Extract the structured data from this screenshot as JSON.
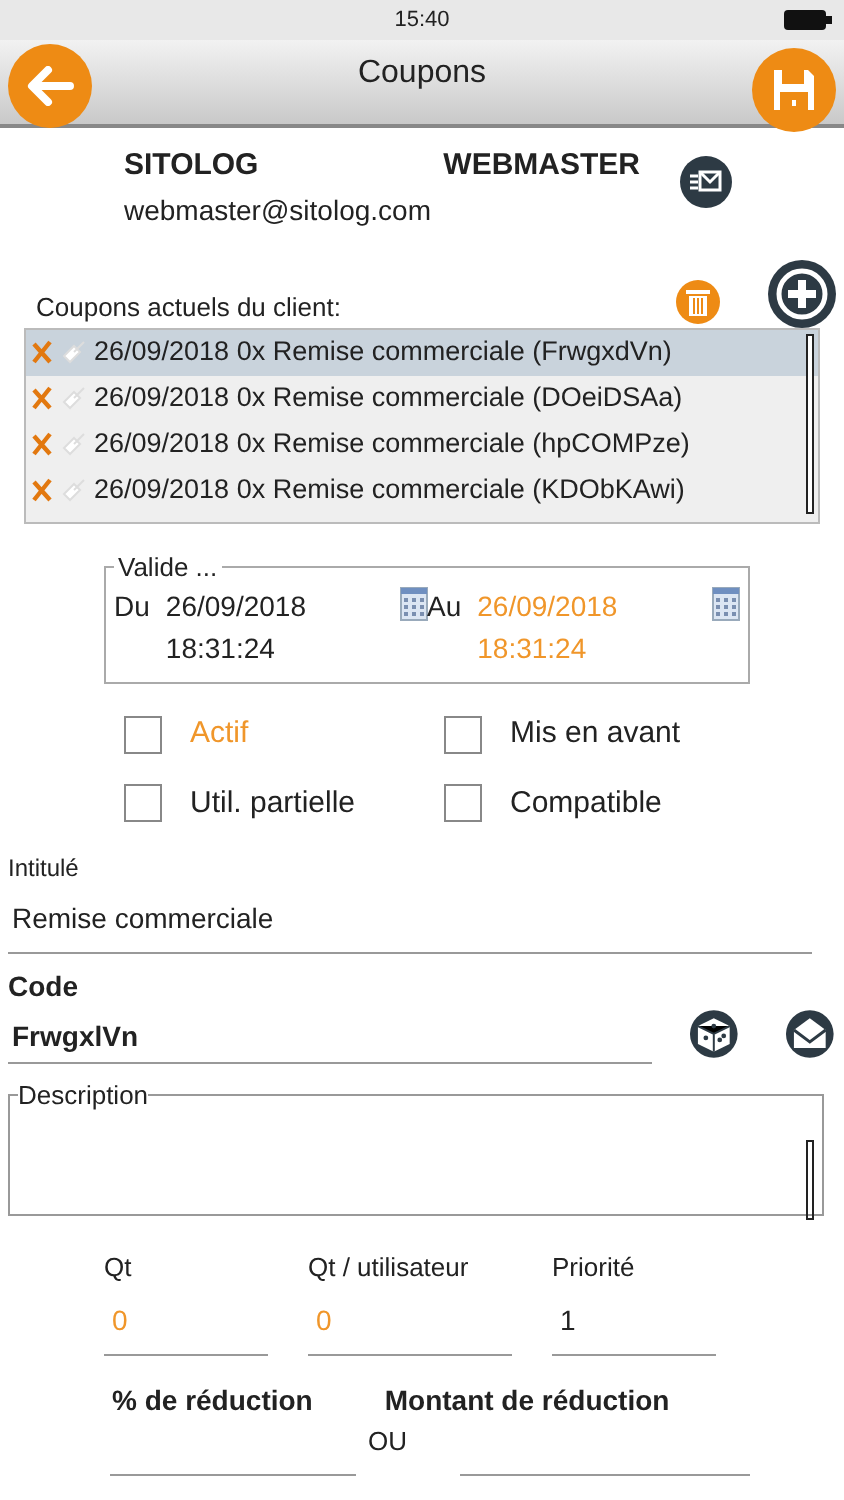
{
  "status_bar": {
    "time": "15:40"
  },
  "header": {
    "title": "Coupons"
  },
  "user": {
    "company": "SITOLOG",
    "name": "WEBMASTER",
    "email": "webmaster@sitolog.com"
  },
  "coupons": {
    "label": "Coupons actuels du client:",
    "items": [
      {
        "text": "26/09/2018 0x Remise commerciale (FrwgxdVn)",
        "selected": true
      },
      {
        "text": "26/09/2018 0x Remise commerciale (DOeiDSAa)",
        "selected": false
      },
      {
        "text": "26/09/2018 0x Remise commerciale (hpCOMPze)",
        "selected": false
      },
      {
        "text": "26/09/2018 0x Remise commerciale (KDObKAwi)",
        "selected": false
      }
    ]
  },
  "validity": {
    "legend": "Valide ...",
    "from": {
      "label": "Du",
      "date": "26/09/2018",
      "time": "18:31:24",
      "highlighted": false
    },
    "to": {
      "label": "Au",
      "date": "26/09/2018",
      "time": "18:31:24",
      "highlighted": true
    }
  },
  "options": [
    {
      "label": "Actif",
      "checked": false,
      "highlighted": true
    },
    {
      "label": "Mis en avant",
      "checked": false,
      "highlighted": false
    },
    {
      "label": "Util. partielle",
      "checked": false,
      "highlighted": false
    },
    {
      "label": "Compatible",
      "checked": false,
      "highlighted": false
    }
  ],
  "title_field": {
    "label": "Intitulé",
    "value": "Remise commerciale"
  },
  "code_field": {
    "label": "Code",
    "value": "FrwgxlVn"
  },
  "description": {
    "legend": "Description"
  },
  "quantities": [
    {
      "label": "Qt",
      "value": "0",
      "highlighted": true
    },
    {
      "label": "Qt / utilisateur",
      "value": "0",
      "highlighted": true
    },
    {
      "label": "Priorité",
      "value": "1",
      "highlighted": false
    }
  ],
  "reduction": {
    "percent_label": "% de réduction",
    "amount_label": "Montant de réduction",
    "separator": "OU"
  }
}
